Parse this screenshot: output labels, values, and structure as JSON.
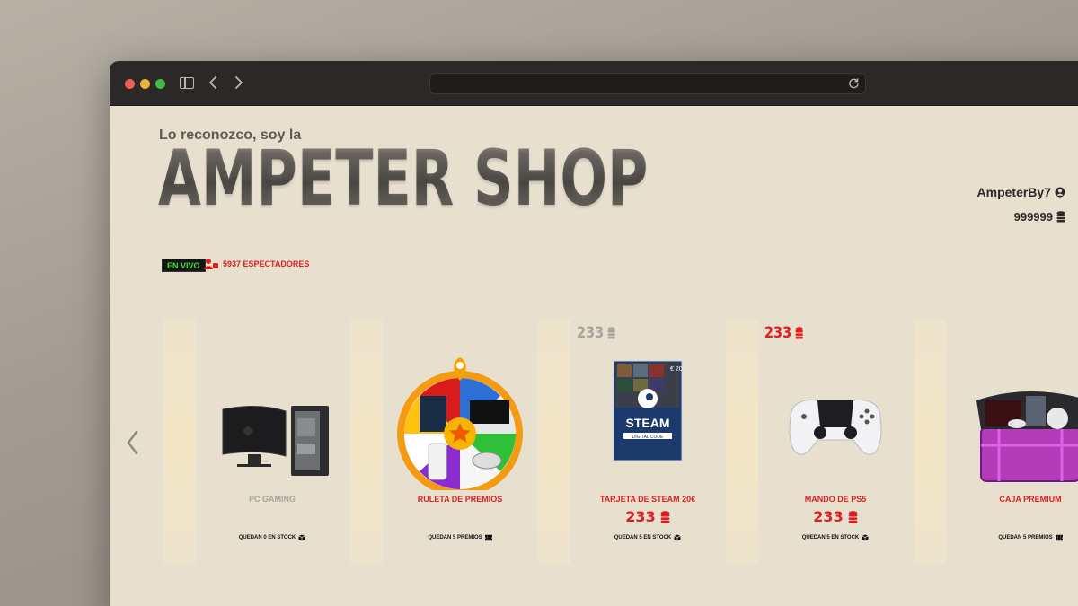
{
  "browser": {
    "address": ""
  },
  "header": {
    "intro": "Lo reconozco, soy la",
    "brand": "AMPETER SHOP",
    "live_label": "EN VIVO",
    "viewers_label": "5937 ESPECTADORES"
  },
  "user": {
    "name": "AmpeterBy7",
    "balance": "999999"
  },
  "colors": {
    "accent_red": "#e01e1e",
    "live_green": "#3fe03f",
    "muted": "#a8a49c"
  },
  "products": [
    {
      "title": "PC GAMING",
      "price_top": "",
      "price": "",
      "stock": "QUEDAN 0 EN STOCK",
      "state": "disabled",
      "art": "pc-gaming"
    },
    {
      "title": "RULETA DE PREMIOS",
      "price_top": "",
      "price": "",
      "stock": "QUEDAN 5 PREMIOS",
      "state": "active",
      "art": "prize-wheel"
    },
    {
      "title": "TARJETA DE STEAM 20€",
      "price_top": "233",
      "price": "233",
      "stock": "QUEDAN 5 EN STOCK",
      "state": "active",
      "price_top_state": "muted",
      "art": "steam-card"
    },
    {
      "title": "MANDO DE PS5",
      "price_top": "233",
      "price": "233",
      "stock": "QUEDAN 5 EN STOCK",
      "state": "active",
      "price_top_state": "red",
      "art": "ps5-controller"
    },
    {
      "title": "CAJA PREMIUM",
      "price_top": "",
      "price": "",
      "stock": "QUEDAN 5 PREMIOS",
      "state": "active",
      "art": "premium-box"
    }
  ]
}
